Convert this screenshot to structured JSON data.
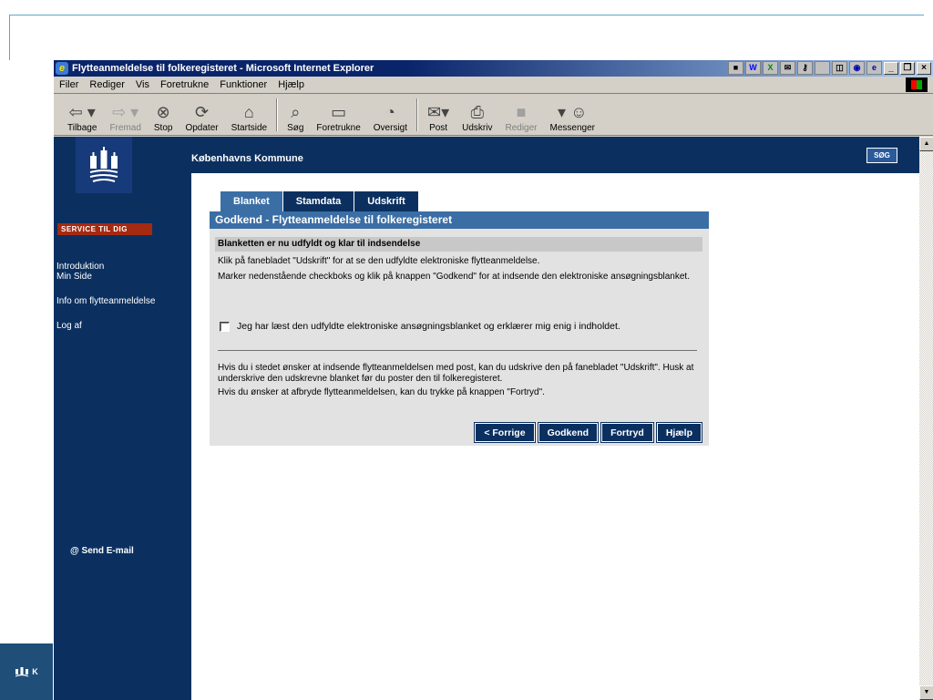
{
  "window": {
    "title": "Flytteanmeldelse til folkeregisteret - Microsoft Internet Explorer"
  },
  "menu": [
    "Filer",
    "Rediger",
    "Vis",
    "Foretrukne",
    "Funktioner",
    "Hjælp"
  ],
  "toolbar": {
    "back": "Tilbage",
    "forward": "Fremad",
    "stop": "Stop",
    "refresh": "Opdater",
    "home": "Startside",
    "search": "Søg",
    "favorites": "Foretrukne",
    "history": "Oversigt",
    "mail": "Post",
    "print": "Udskriv",
    "edit": "Rediger",
    "messenger": "Messenger"
  },
  "site": {
    "name": "Københavns Kommune",
    "search_button": "SØG",
    "service_badge": "SERVICE TIL DIG",
    "nav": [
      "Introduktion",
      "Min Side",
      "Info om flytteanmeldelse",
      "Log af"
    ],
    "send_email": "@ Send E-mail"
  },
  "tabs": [
    "Blanket",
    "Stamdata",
    "Udskrift"
  ],
  "form": {
    "header": "Godkend - Flytteanmeldelse til folkeregisteret",
    "subhead": "Blanketten er nu udfyldt og klar til indsendelse",
    "p1": "Klik på fanebladet \"Udskrift\" for at se den udfyldte elektroniske flytteanmeldelse.",
    "p2": "Marker nedenstående checkboks og klik på knappen \"Godkend\" for at indsende den elektroniske ansøgningsblanket.",
    "checkbox_label": "Jeg har læst den udfyldte elektroniske ansøgningsblanket og erklærer mig enig i indholdet.",
    "p3": "Hvis du i stedet ønsker at indsende flytteanmeldelsen med post, kan du udskrive den på fanebladet \"Udskrift\". Husk at underskrive den udskrevne blanket før du poster den til folkeregisteret.",
    "p4": "Hvis du ønsker at afbryde flytteanmeldelsen, kan du trykke på knappen \"Fortryd\".",
    "buttons": [
      "< Forrige",
      "Godkend",
      "Fortryd",
      "Hjælp"
    ]
  },
  "slide_logo_text": "K",
  "colors": {
    "navy": "#0b3060",
    "tab_blue": "#3a6ea5",
    "service_red": "#a52a12"
  }
}
